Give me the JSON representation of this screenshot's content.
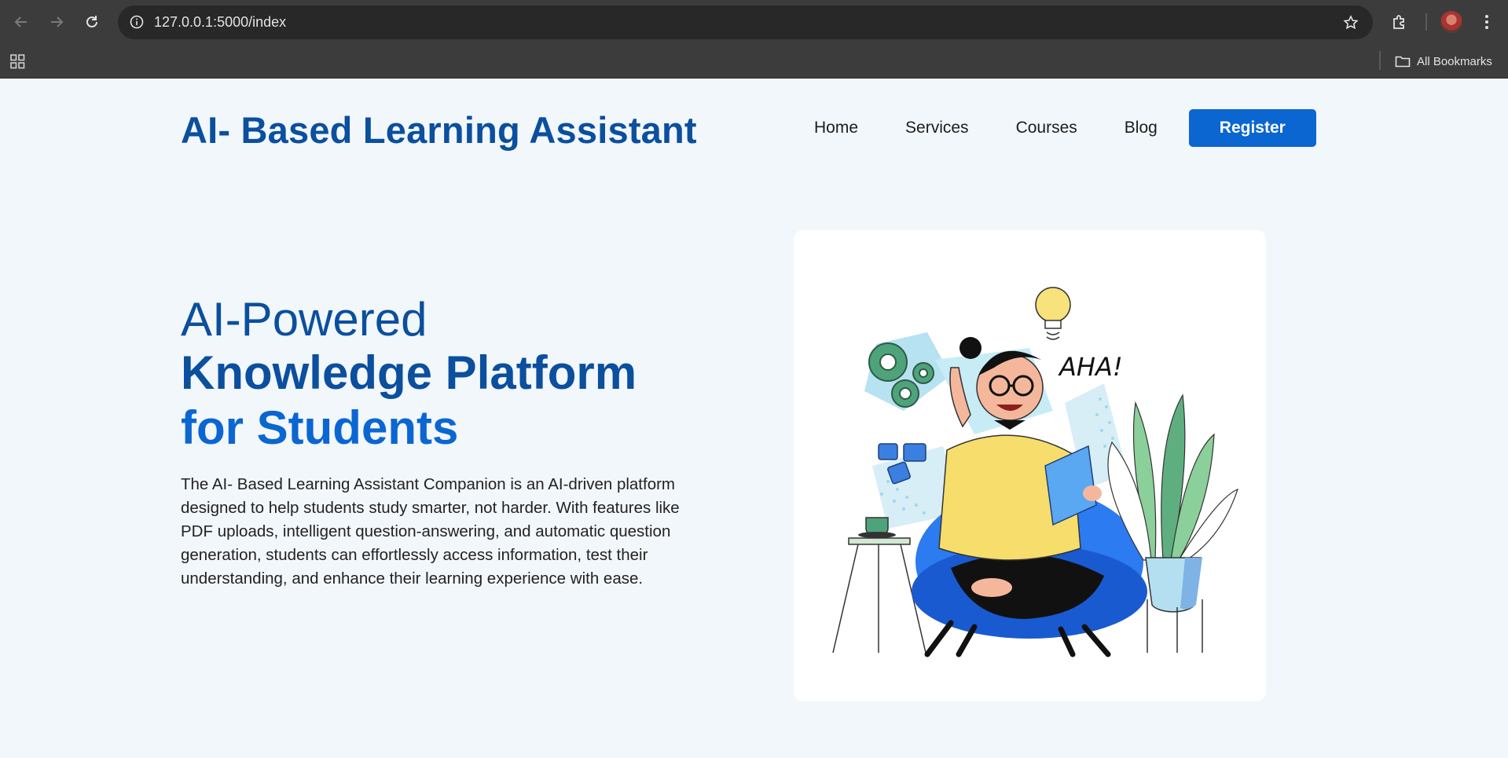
{
  "browser": {
    "url": "127.0.0.1:5000/index",
    "bookmarks_label": "All Bookmarks",
    "icons": [
      "back-icon",
      "forward-icon",
      "reload-icon",
      "info-icon",
      "star-icon",
      "extensions-icon",
      "profile-avatar",
      "menu-icon",
      "apps-grid-icon",
      "folder-icon"
    ]
  },
  "header": {
    "title": "AI- Based Learning Assistant",
    "nav": [
      "Home",
      "Services",
      "Courses",
      "Blog"
    ],
    "register_label": "Register"
  },
  "hero": {
    "line1": "AI-Powered",
    "line2": "Knowledge Platform",
    "line3": "for Students",
    "description": "The AI- Based Learning Assistant Companion is an AI-driven platform designed to help students study smarter, not harder. With features like PDF uploads, intelligent question-answering, and automatic question generation, students can effortlessly access information, test their understanding, and enhance their learning experience with ease."
  },
  "illustration": {
    "caption_text": "AHA!"
  },
  "colors": {
    "brand_dark": "#0b4f9e",
    "brand_blue": "#0b66d1",
    "page_bg": "#f2f7fb"
  }
}
